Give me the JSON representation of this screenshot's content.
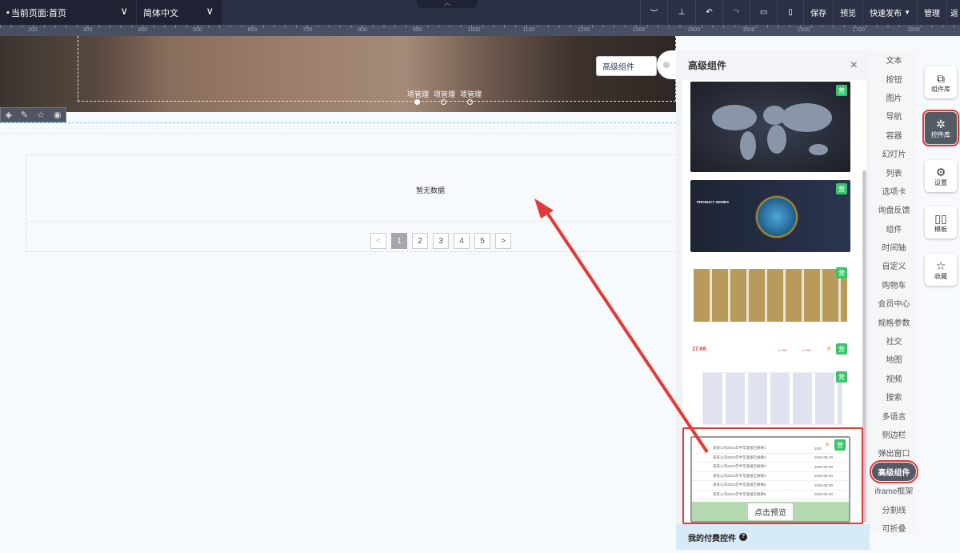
{
  "topbar": {
    "page_select": "当前页面:首页",
    "lang_select": "简体中文",
    "buttons": {
      "save": "保存",
      "preview": "预览",
      "publish": "快速发布",
      "manage": "管理",
      "back": "返"
    }
  },
  "ruler": {
    "ticks": [
      "200",
      "300",
      "400",
      "500",
      "600",
      "700",
      "800",
      "900",
      "1000",
      "1100",
      "1200",
      "1300",
      "1400",
      "1500",
      "1600",
      "1700",
      "1800"
    ]
  },
  "banner": {
    "nav_items": [
      "项管理",
      "项管理",
      "项管理"
    ]
  },
  "canvas": {
    "empty_text": "暂无数据",
    "pager": {
      "prev": "<",
      "pages": [
        "1",
        "2",
        "3",
        "4",
        "5"
      ],
      "next": ">",
      "current": "1"
    }
  },
  "tooltip": "高级组件",
  "panel": {
    "title": "高级组件",
    "close": "×",
    "badge": "营",
    "preview_btn": "点击预览",
    "paid_label": "我的付费控件",
    "help": "?",
    "product_series": "PRODUCT SERIES",
    "stats": [
      "17.68",
      "17.68",
      "17.68"
    ],
    "list_rows": [
      {
        "t": "某某公司2024年半年度报告摘要1",
        "d": "2025-08-30"
      },
      {
        "t": "某某公司2024年半年度报告摘要2",
        "d": "2025-08-30"
      },
      {
        "t": "某某公司2024年半年度报告摘要3",
        "d": "2025-08-30"
      },
      {
        "t": "某某公司2024年半年度报告摘要4",
        "d": "2025-08-30"
      },
      {
        "t": "某某公司2024年半年度报告摘要5",
        "d": "2025-08-30"
      },
      {
        "t": "某某公司2024年半年度报告摘要6",
        "d": "2025-08-30"
      }
    ]
  },
  "categories": [
    "文本",
    "按钮",
    "图片",
    "导航",
    "容器",
    "幻灯片",
    "列表",
    "选项卡",
    "询盘反馈",
    "组件",
    "时间轴",
    "自定义",
    "购物车",
    "会员中心",
    "规格参数",
    "社交",
    "地图",
    "视频",
    "搜索",
    "多语言",
    "侧边栏",
    "弹出窗口",
    "高级组件",
    "iframe框架",
    "分割线",
    "可折叠"
  ],
  "active_category": "高级组件",
  "right_tools": [
    {
      "label": "组件库",
      "icon": "⧉"
    },
    {
      "label": "控件库",
      "icon": "✲"
    },
    {
      "label": "设置",
      "icon": "⚙"
    },
    {
      "label": "模板",
      "icon": "▯▯"
    },
    {
      "label": "收藏",
      "icon": "☆"
    }
  ],
  "colors": {
    "accent_red": "#e53935",
    "badge_green": "#3cc46c",
    "topbar": "#2b3045"
  }
}
